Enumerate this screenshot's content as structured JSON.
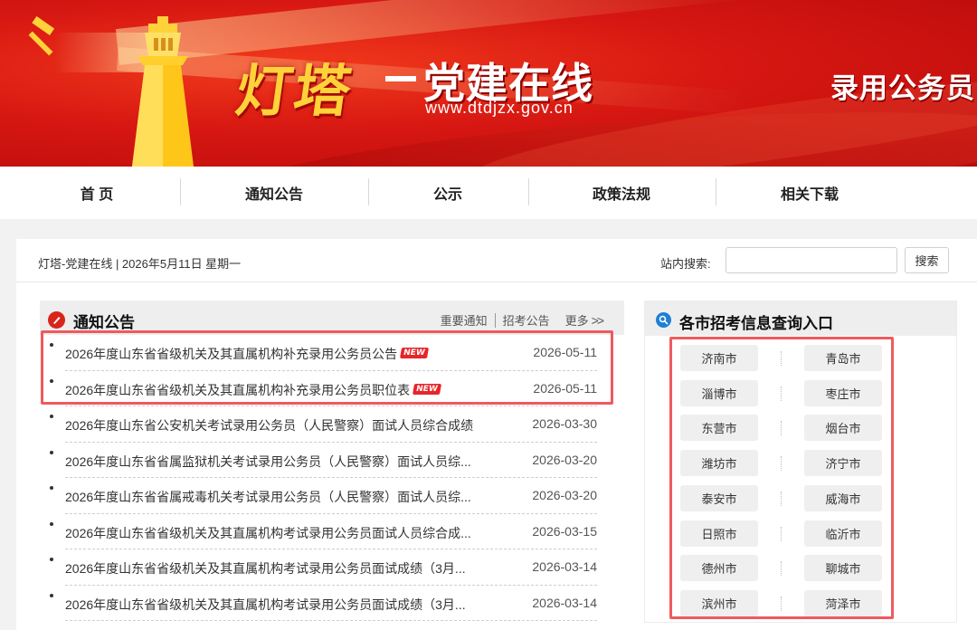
{
  "banner": {
    "logo_title": "灯塔",
    "logo_subtitle": "党建在线",
    "logo_url": "www.dtdjzx.gov.cn",
    "right_text": "录用公务员"
  },
  "nav": {
    "items": [
      {
        "label": "首 页"
      },
      {
        "label": "通知公告"
      },
      {
        "label": "公示"
      },
      {
        "label": "政策法规"
      },
      {
        "label": "相关下载"
      }
    ]
  },
  "info_bar": {
    "date_line": "灯塔-党建在线 | 2026年5月11日 星期一",
    "search_label": "站内搜索:",
    "search_value": "",
    "search_button": "搜索"
  },
  "notices": {
    "title": "通知公告",
    "link_important": "重要通知",
    "link_recruit": "招考公告",
    "link_more": "更多",
    "new_badge": "NEW",
    "items": [
      {
        "title": "2026年度山东省省级机关及其直属机构补充录用公务员公告",
        "date": "2026-05-11",
        "is_new": true
      },
      {
        "title": "2026年度山东省省级机关及其直属机构补充录用公务员职位表",
        "date": "2026-05-11",
        "is_new": true
      },
      {
        "title": "2026年度山东省公安机关考试录用公务员（人民警察）面试人员综合成绩",
        "date": "2026-03-30",
        "is_new": false
      },
      {
        "title": "2026年度山东省省属监狱机关考试录用公务员（人民警察）面试人员综...",
        "date": "2026-03-20",
        "is_new": false
      },
      {
        "title": "2026年度山东省省属戒毒机关考试录用公务员（人民警察）面试人员综...",
        "date": "2026-03-20",
        "is_new": false
      },
      {
        "title": "2026年度山东省省级机关及其直属机构考试录用公务员面试人员综合成...",
        "date": "2026-03-15",
        "is_new": false
      },
      {
        "title": "2026年度山东省省级机关及其直属机构考试录用公务员面试成绩（3月...",
        "date": "2026-03-14",
        "is_new": false
      },
      {
        "title": "2026年度山东省省级机关及其直属机构考试录用公务员面试成绩（3月...",
        "date": "2026-03-14",
        "is_new": false
      }
    ]
  },
  "cities": {
    "title": "各市招考信息查询入口",
    "items": [
      "济南市",
      "青岛市",
      "淄博市",
      "枣庄市",
      "东营市",
      "烟台市",
      "潍坊市",
      "济宁市",
      "泰安市",
      "威海市",
      "日照市",
      "临沂市",
      "德州市",
      "聊城市",
      "滨州市",
      "菏泽市"
    ]
  },
  "colors": {
    "banner_red": "#d71712",
    "accent_red": "#d9241b",
    "highlight": "#ef5a5e",
    "logo_gold": "#ffd23a",
    "search_icon_blue": "#1e7fd6"
  },
  "icons": {
    "emblem": "hammer-sickle-icon",
    "lighthouse": "lighthouse-icon",
    "notice": "notice-icon",
    "search": "search-icon",
    "more": "double-chevron-right-icon"
  }
}
